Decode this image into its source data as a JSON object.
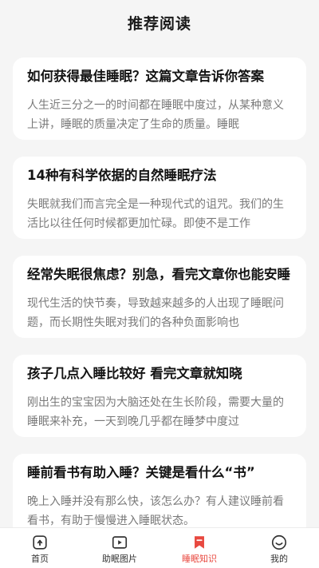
{
  "header": {
    "title": "推荐阅读"
  },
  "articles": [
    {
      "title": "如何获得最佳睡眠？这篇文章告诉你答案",
      "summary": "人生近三分之一的时间都在睡眠中度过，从某种意义上讲，睡眠的质量决定了生命的质量。睡眠"
    },
    {
      "title": "14种有科学依据的自然睡眠疗法",
      "summary": "失眠就我们而言完全是一种现代式的诅咒。我们的生活比以往任何时候都更加忙碌。即使不是工作"
    },
    {
      "title": "经常失眠很焦虑？别急，看完文章你也能安睡",
      "summary": "现代生活的快节奏，导致越来越多的人出现了睡眠问题，而长期性失眠对我们的各种负面影响也"
    },
    {
      "title": "孩子几点入睡比较好 看完文章就知晓",
      "summary": "刚出生的宝宝因为大脑还处在生长阶段，需要大量的睡眠来补充，一天到晚几乎都在睡梦中度过"
    },
    {
      "title": "睡前看书有助入睡？关键是看什么“书”",
      "summary": "晚上入睡并没有那么快，该怎么办？有人建议睡前看看书，有助于慢慢进入睡眠状态。"
    }
  ],
  "tabbar": {
    "items": [
      {
        "label": "首页",
        "icon": "home-icon",
        "active": false
      },
      {
        "label": "助眠图片",
        "icon": "play-icon",
        "active": false
      },
      {
        "label": "睡眠知识",
        "icon": "bookmark-icon",
        "active": true
      },
      {
        "label": "我的",
        "icon": "smile-icon",
        "active": false
      }
    ],
    "active_color": "#e8483f",
    "inactive_color": "#333333"
  }
}
